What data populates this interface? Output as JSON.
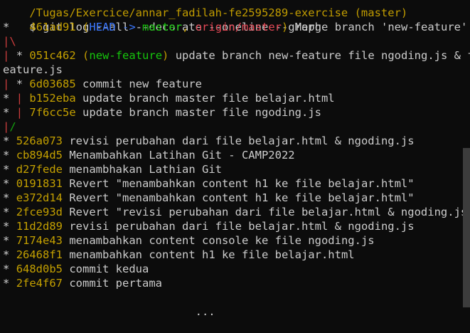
{
  "prompt": {
    "path_line": "/Tugas/Exercice/annar_fadilah-fe2595289-exercise (master)",
    "symbol": "$",
    "command": "git log --all --decorate --oneline --graph"
  },
  "commits": [
    {
      "graph": "*   ",
      "hash": "461ad91",
      "head": "HEAD -> ",
      "branch": "master",
      "sep": ", ",
      "remote": "origin/master",
      "msg": " Merge branch 'new-feature'"
    },
    {
      "graph": "|\\",
      "hash": "",
      "msg": ""
    },
    {
      "graph": "| * ",
      "hash": "051c462",
      "branch": "new-feature",
      "msg": " update branch new-feature file ngoding.js & f"
    },
    {
      "graph": "",
      "hash": "",
      "msg": "eature.js"
    },
    {
      "graph": "| * ",
      "hash": "6d03685",
      "msg": " commit new feature"
    },
    {
      "graph": "* | ",
      "hash": "b152eba",
      "msg": " update branch master file belajar.html"
    },
    {
      "graph": "* | ",
      "hash": "7f6cc5e",
      "msg": " update branch master file ngoding.js"
    },
    {
      "graph": "|/",
      "hash": "",
      "msg": ""
    },
    {
      "graph": "* ",
      "hash": "526a073",
      "msg": " revisi perubahan dari file belajar.html & ngoding.js"
    },
    {
      "graph": "* ",
      "hash": "cb894d5",
      "msg": " Menambahkan Latihan Git - CAMP2022"
    },
    {
      "graph": "* ",
      "hash": "d27fede",
      "msg": " menambhakan Lathian Git"
    },
    {
      "graph": "* ",
      "hash": "0191831",
      "msg": " Revert \"menambahkan content h1 ke file belajar.html\""
    },
    {
      "graph": "* ",
      "hash": "e372d14",
      "msg": " Revert \"menambahkan content h1 ke file belajar.html\""
    },
    {
      "graph": "* ",
      "hash": "2fce93d",
      "msg": " Revert \"revisi perubahan dari file belajar.html & ngoding.js\""
    },
    {
      "graph": "* ",
      "hash": "11d2d89",
      "msg": " revisi perubahan dari file belajar.html & ngoding.js"
    },
    {
      "graph": "* ",
      "hash": "7174e43",
      "msg": " menambahkan content console ke file ngoding.js"
    },
    {
      "graph": "* ",
      "hash": "26468f1",
      "msg": " menambahkan content h1 ke file belajar.html"
    },
    {
      "graph": "* ",
      "hash": "648d0b5",
      "msg": " commit kedua"
    },
    {
      "graph": "* ",
      "hash": "2fe4f67",
      "msg": " commit pertama"
    }
  ],
  "footer_line": "                         ...",
  "colors": {
    "background": "#0c0c0c",
    "text": "#cccccc",
    "hash": "#c4a000",
    "graph_red": "#cc3d3d",
    "graph_green": "#13a10e",
    "head": "#3b78ff",
    "branch": "#16c60c",
    "remote": "#e74856"
  }
}
